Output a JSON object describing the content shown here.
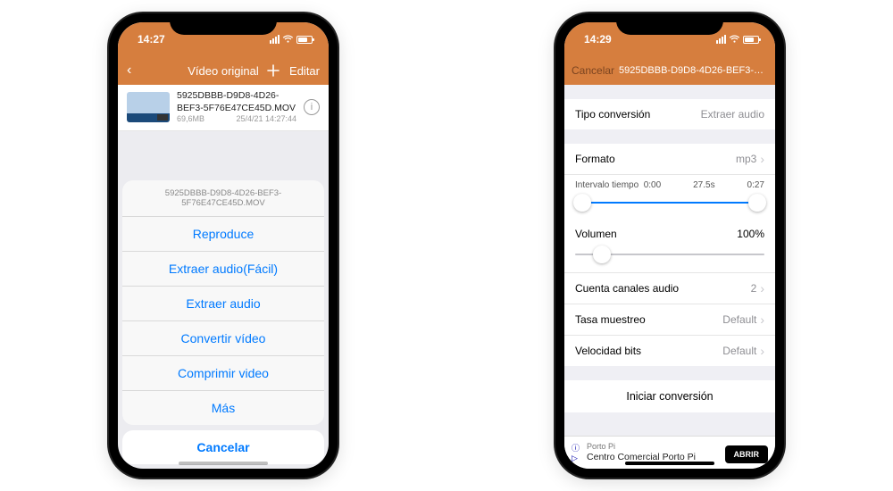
{
  "left": {
    "status_time": "14:27",
    "nav_title": "Vídeo original",
    "nav_edit": "Editar",
    "file": {
      "name": "5925DBBB-D9D8-4D26-BEF3-5F76E47CE45D.MOV",
      "size": "69,6MB",
      "date": "25/4/21 14:27:44"
    },
    "sheet_title": "5925DBBB-D9D8-4D26-BEF3-5F76E47CE45D.MOV",
    "actions": [
      "Reproduce",
      "Extraer audio(Fácil)",
      "Extraer audio",
      "Convertir vídeo",
      "Comprimir video",
      "Más"
    ],
    "cancel": "Cancelar"
  },
  "right": {
    "status_time": "14:29",
    "nav_cancel": "Cancelar",
    "nav_title": "5925DBBB-D9D8-4D26-BEF3-…",
    "type": {
      "label": "Tipo conversión",
      "value": "Extraer audio"
    },
    "format": {
      "label": "Formato",
      "value": "mp3"
    },
    "interval": {
      "label": "Intervalo tiempo",
      "start": "0:00",
      "mid": "27.5s",
      "end": "0:27"
    },
    "volume": {
      "label": "Volumen",
      "value": "100%"
    },
    "channels": {
      "label": "Cuenta canales audio",
      "value": "2"
    },
    "sample": {
      "label": "Tasa muestreo",
      "value": "Default"
    },
    "bitrate": {
      "label": "Velocidad bits",
      "value": "Default"
    },
    "start_button": "Iniciar conversión",
    "ad": {
      "line1": "Porto Pi",
      "line2": "Centro Comercial Porto Pi",
      "cta": "ABRIR"
    }
  }
}
